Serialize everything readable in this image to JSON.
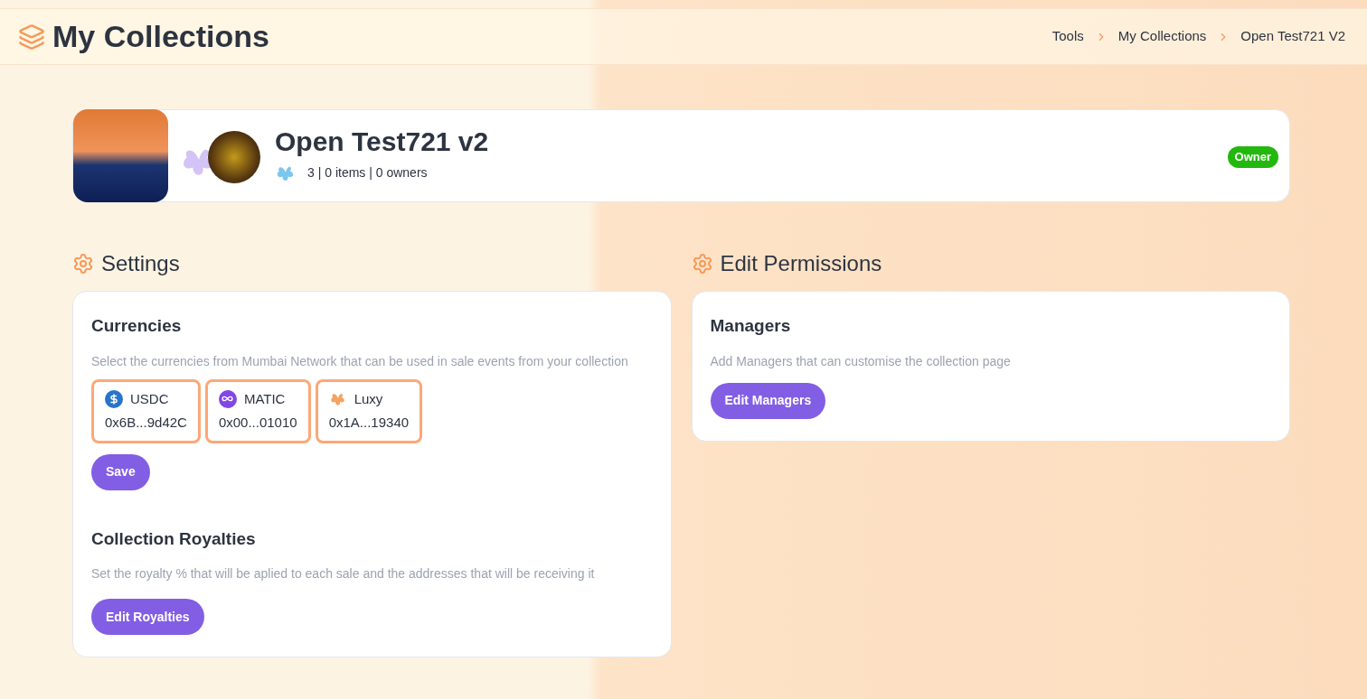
{
  "header": {
    "title": "My Collections",
    "breadcrumbs": [
      "Tools",
      "My Collections",
      "Open Test721 V2"
    ]
  },
  "collection": {
    "name": "Open Test721 v2",
    "stats": "3 | 0 items | 0 owners",
    "badge": "Owner"
  },
  "settings": {
    "title": "Settings",
    "currencies": {
      "title": "Currencies",
      "description": "Select the currencies from Mumbai Network that can be used in sale events from your collection",
      "items": [
        {
          "kind": "usdc",
          "name": "USDC",
          "address": "0x6B...9d42C",
          "selected": true
        },
        {
          "kind": "matic",
          "name": "MATIC",
          "address": "0x00...01010",
          "selected": true
        },
        {
          "kind": "luxy",
          "name": "Luxy",
          "address": "0x1A...19340",
          "selected": true
        }
      ],
      "button": "Save"
    },
    "royalties": {
      "title": "Collection Royalties",
      "description": "Set the royalty % that will be aplied to each sale and the addresses that will be receiving it",
      "button": "Edit Royalties"
    }
  },
  "permissions": {
    "title": "Edit Permissions",
    "managers": {
      "title": "Managers",
      "description": "Add Managers that can customise the collection page",
      "button": "Edit Managers"
    }
  }
}
